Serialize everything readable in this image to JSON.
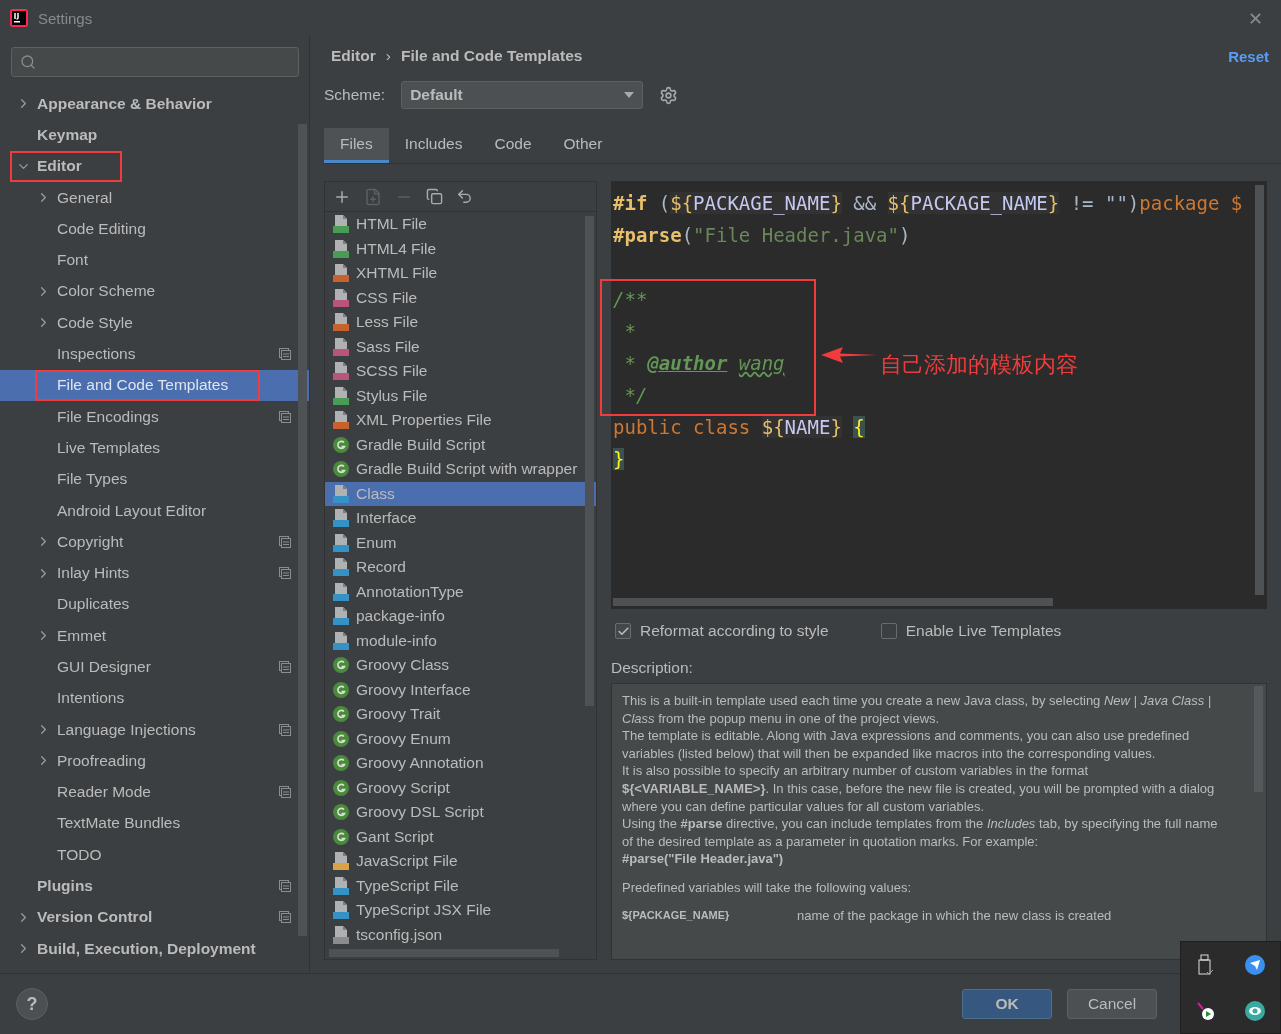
{
  "window": {
    "title": "Settings",
    "close": "✕"
  },
  "sidebar": {
    "items": [
      {
        "label": "Appearance & Behavior",
        "kind": "folder",
        "expanded": false,
        "selected": false,
        "scoped": false
      },
      {
        "label": "Keymap",
        "kind": "leaf",
        "selected": false,
        "scoped": false
      },
      {
        "label": "Editor",
        "kind": "folder",
        "expanded": true,
        "selected": false,
        "scoped": false,
        "children": [
          {
            "label": "General",
            "kind": "folder",
            "expanded": false,
            "selected": false,
            "scoped": false
          },
          {
            "label": "Code Editing",
            "kind": "leaf",
            "selected": false,
            "scoped": false
          },
          {
            "label": "Font",
            "kind": "leaf",
            "selected": false,
            "scoped": false
          },
          {
            "label": "Color Scheme",
            "kind": "folder",
            "expanded": false,
            "selected": false,
            "scoped": false
          },
          {
            "label": "Code Style",
            "kind": "folder",
            "expanded": false,
            "selected": false,
            "scoped": false
          },
          {
            "label": "Inspections",
            "kind": "leaf",
            "selected": false,
            "scoped": true
          },
          {
            "label": "File and Code Templates",
            "kind": "leaf",
            "selected": true,
            "scoped": false
          },
          {
            "label": "File Encodings",
            "kind": "leaf",
            "selected": false,
            "scoped": true
          },
          {
            "label": "Live Templates",
            "kind": "leaf",
            "selected": false,
            "scoped": false
          },
          {
            "label": "File Types",
            "kind": "leaf",
            "selected": false,
            "scoped": false
          },
          {
            "label": "Android Layout Editor",
            "kind": "leaf",
            "selected": false,
            "scoped": false
          },
          {
            "label": "Copyright",
            "kind": "folder",
            "expanded": false,
            "selected": false,
            "scoped": true
          },
          {
            "label": "Inlay Hints",
            "kind": "folder",
            "expanded": false,
            "selected": false,
            "scoped": true
          },
          {
            "label": "Duplicates",
            "kind": "leaf",
            "selected": false,
            "scoped": false
          },
          {
            "label": "Emmet",
            "kind": "folder",
            "expanded": false,
            "selected": false,
            "scoped": false
          },
          {
            "label": "GUI Designer",
            "kind": "leaf",
            "selected": false,
            "scoped": true
          },
          {
            "label": "Intentions",
            "kind": "leaf",
            "selected": false,
            "scoped": false
          },
          {
            "label": "Language Injections",
            "kind": "folder",
            "expanded": false,
            "selected": false,
            "scoped": true
          },
          {
            "label": "Proofreading",
            "kind": "folder",
            "expanded": false,
            "selected": false,
            "scoped": false
          },
          {
            "label": "Reader Mode",
            "kind": "leaf",
            "selected": false,
            "scoped": true
          },
          {
            "label": "TextMate Bundles",
            "kind": "leaf",
            "selected": false,
            "scoped": false
          },
          {
            "label": "TODO",
            "kind": "leaf",
            "selected": false,
            "scoped": false
          }
        ]
      },
      {
        "label": "Plugins",
        "kind": "leaf",
        "selected": false,
        "scoped": true
      },
      {
        "label": "Version Control",
        "kind": "folder",
        "expanded": false,
        "selected": false,
        "scoped": true
      },
      {
        "label": "Build, Execution, Deployment",
        "kind": "folder",
        "expanded": false,
        "selected": false,
        "scoped": false
      }
    ]
  },
  "breadcrumb": {
    "items": [
      "Editor",
      "File and Code Templates"
    ],
    "separator": "›"
  },
  "reset": "Reset",
  "scheme": {
    "label": "Scheme:",
    "value": "Default"
  },
  "tabs": [
    {
      "label": "Files",
      "selected": true
    },
    {
      "label": "Includes",
      "selected": false
    },
    {
      "label": "Code",
      "selected": false
    },
    {
      "label": "Other",
      "selected": false
    }
  ],
  "templates": [
    {
      "label": "HTML File",
      "kind": "file",
      "color": "#499c54",
      "selected": false
    },
    {
      "label": "HTML4 File",
      "kind": "file",
      "color": "#499c54",
      "selected": false
    },
    {
      "label": "XHTML File",
      "kind": "file",
      "color": "#c7622c",
      "selected": false
    },
    {
      "label": "CSS File",
      "kind": "file",
      "color": "#b8557a",
      "selected": false
    },
    {
      "label": "Less File",
      "kind": "file",
      "color": "#c7622c",
      "selected": false
    },
    {
      "label": "Sass File",
      "kind": "file",
      "color": "#b8557a",
      "selected": false
    },
    {
      "label": "SCSS File",
      "kind": "file",
      "color": "#b8557a",
      "selected": false
    },
    {
      "label": "Stylus File",
      "kind": "file",
      "color": "#499c54",
      "selected": false
    },
    {
      "label": "XML Properties File",
      "kind": "file",
      "color": "#c7622c",
      "selected": false
    },
    {
      "label": "Gradle Build Script",
      "kind": "groovy",
      "color": "#4a8a3c",
      "selected": false
    },
    {
      "label": "Gradle Build Script with wrapper",
      "kind": "groovy",
      "color": "#4a8a3c",
      "selected": false
    },
    {
      "label": "Class",
      "kind": "file",
      "color": "#3592c4",
      "selected": true
    },
    {
      "label": "Interface",
      "kind": "file",
      "color": "#3592c4",
      "selected": false
    },
    {
      "label": "Enum",
      "kind": "file",
      "color": "#3592c4",
      "selected": false
    },
    {
      "label": "Record",
      "kind": "file",
      "color": "#3592c4",
      "selected": false
    },
    {
      "label": "AnnotationType",
      "kind": "file",
      "color": "#3592c4",
      "selected": false
    },
    {
      "label": "package-info",
      "kind": "file",
      "color": "#3592c4",
      "selected": false
    },
    {
      "label": "module-info",
      "kind": "file",
      "color": "#3592c4",
      "selected": false
    },
    {
      "label": "Groovy Class",
      "kind": "groovy",
      "color": "#4a8a3c",
      "selected": false
    },
    {
      "label": "Groovy Interface",
      "kind": "groovy",
      "color": "#4a8a3c",
      "selected": false
    },
    {
      "label": "Groovy Trait",
      "kind": "groovy",
      "color": "#4a8a3c",
      "selected": false
    },
    {
      "label": "Groovy Enum",
      "kind": "groovy",
      "color": "#4a8a3c",
      "selected": false
    },
    {
      "label": "Groovy Annotation",
      "kind": "groovy",
      "color": "#4a8a3c",
      "selected": false
    },
    {
      "label": "Groovy Script",
      "kind": "groovy",
      "color": "#4a8a3c",
      "selected": false
    },
    {
      "label": "Groovy DSL Script",
      "kind": "groovy",
      "color": "#4a8a3c",
      "selected": false
    },
    {
      "label": "Gant Script",
      "kind": "groovy",
      "color": "#4a8a3c",
      "selected": false
    },
    {
      "label": "JavaScript File",
      "kind": "file",
      "color": "#d9a343",
      "selected": false
    },
    {
      "label": "TypeScript File",
      "kind": "file",
      "color": "#3592c4",
      "selected": false
    },
    {
      "label": "TypeScript JSX File",
      "kind": "file",
      "color": "#3592c4",
      "selected": false
    },
    {
      "label": "tsconfig.json",
      "kind": "file",
      "color": "#8c8c8c",
      "selected": false
    }
  ],
  "code": [
    {
      "kind": "code",
      "segments": [
        {
          "text": "#if",
          "kind": "directive"
        },
        {
          "text": " (",
          "kind": "punct"
        },
        {
          "text": "${",
          "kind": "macro"
        },
        {
          "text": "PACKAGE_NAME",
          "kind": "var"
        },
        {
          "text": "}",
          "kind": "macro"
        },
        {
          "text": " && ",
          "kind": "punct"
        },
        {
          "text": "${",
          "kind": "macro"
        },
        {
          "text": "PACKAGE_NAME",
          "kind": "var"
        },
        {
          "text": "}",
          "kind": "macro"
        },
        {
          "text": " != \"\")",
          "kind": "punct"
        },
        {
          "text": "package $",
          "kind": "keyword"
        }
      ]
    },
    {
      "kind": "code",
      "segments": [
        {
          "text": "#parse",
          "kind": "directive"
        },
        {
          "text": "(",
          "kind": "punct"
        },
        {
          "text": "\"File Header.java\"",
          "kind": "string"
        },
        {
          "text": ")",
          "kind": "punct"
        }
      ]
    },
    {
      "kind": "blank"
    },
    {
      "kind": "code",
      "segments": [
        {
          "text": "/**",
          "kind": "comment"
        }
      ]
    },
    {
      "kind": "code",
      "segments": [
        {
          "text": " *",
          "kind": "comment"
        }
      ]
    },
    {
      "kind": "code",
      "segments": [
        {
          "text": " * ",
          "kind": "comment"
        },
        {
          "text": "@author",
          "kind": "tag"
        },
        {
          "text": "wang",
          "kind": "typo"
        }
      ]
    },
    {
      "kind": "code",
      "segments": [
        {
          "text": " */",
          "kind": "comment"
        }
      ]
    },
    {
      "kind": "code",
      "segments": [
        {
          "text": "public class ",
          "kind": "keyword"
        },
        {
          "text": "${",
          "kind": "macro"
        },
        {
          "text": "NAME",
          "kind": "var"
        },
        {
          "text": "}",
          "kind": "macro"
        },
        {
          "text": "{",
          "kind": "open-brace"
        }
      ]
    },
    {
      "kind": "code",
      "segments": [
        {
          "text": "}",
          "kind": "brace"
        }
      ]
    }
  ],
  "options": [
    {
      "label": "Reformat according to style",
      "checked": true
    },
    {
      "label": "Enable Live Templates",
      "checked": false
    }
  ],
  "description": {
    "label": "Description:",
    "paragraphs": [
      {
        "kind": "text",
        "text": "This is a built-in template used each time you create a new Java class, by selecting *New | Java Class | Class* from the popup menu in one of the project views."
      },
      {
        "kind": "text",
        "text": "The template is editable. Along with Java expressions and comments, you can also use predefined variables (listed below) that will then be expanded like macros into the corresponding values."
      },
      {
        "kind": "text",
        "text": "It is also possible to specify an arbitrary number of custom variables in the format **${<VARIABLE_NAME>}**. In this case, before the new file is created, you will be prompted with a dialog where you can define particular values for all custom variables."
      },
      {
        "kind": "text",
        "text": "Using the **#parse** directive, you can include templates from the *Includes* tab, by specifying the full name of the desired template as a parameter in quotation marks. For example:"
      },
      {
        "kind": "code",
        "text": "#parse(\"File Header.java\")"
      },
      {
        "kind": "heading",
        "text": "Predefined variables will take the following values:"
      }
    ],
    "variables": [
      {
        "name": "${PACKAGE_NAME}",
        "meaning": "name of the package in which the new class is created"
      }
    ]
  },
  "help": "?",
  "buttons": [
    {
      "label": "OK",
      "primary": true
    },
    {
      "label": "Cancel",
      "primary": false
    }
  ],
  "annotation": {
    "text": "自己添加的模板内容"
  }
}
